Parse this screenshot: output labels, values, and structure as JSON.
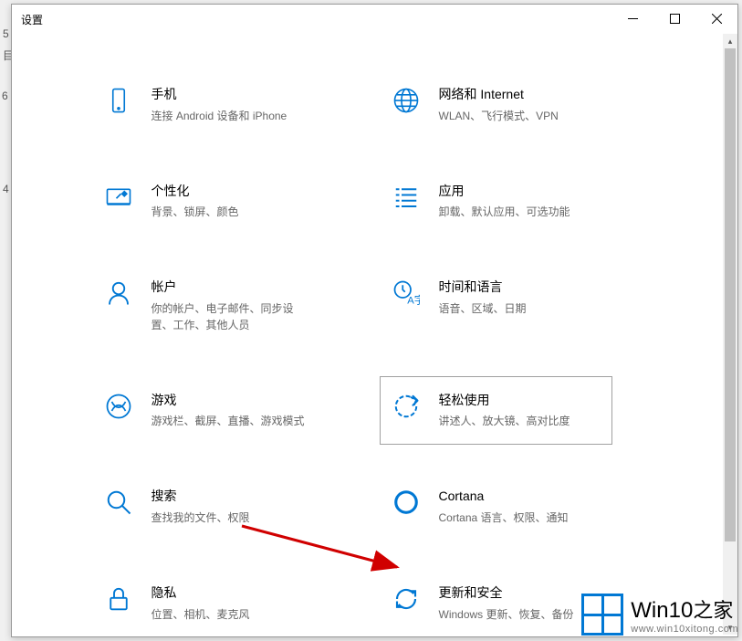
{
  "window": {
    "title": "设置"
  },
  "cards": [
    {
      "title": "手机",
      "subtitle": "连接 Android 设备和 iPhone",
      "icon": "phone-icon"
    },
    {
      "title": "网络和 Internet",
      "subtitle": "WLAN、飞行模式、VPN",
      "icon": "network-icon"
    },
    {
      "title": "个性化",
      "subtitle": "背景、锁屏、颜色",
      "icon": "personalization-icon"
    },
    {
      "title": "应用",
      "subtitle": "卸载、默认应用、可选功能",
      "icon": "apps-icon"
    },
    {
      "title": "帐户",
      "subtitle": "你的帐户、电子邮件、同步设置、工作、其他人员",
      "icon": "accounts-icon"
    },
    {
      "title": "时间和语言",
      "subtitle": "语音、区域、日期",
      "icon": "time-language-icon"
    },
    {
      "title": "游戏",
      "subtitle": "游戏栏、截屏、直播、游戏模式",
      "icon": "gaming-icon"
    },
    {
      "title": "轻松使用",
      "subtitle": "讲述人、放大镜、高对比度",
      "icon": "ease-of-access-icon",
      "hover": true
    },
    {
      "title": "搜索",
      "subtitle": "查找我的文件、权限",
      "icon": "search-icon"
    },
    {
      "title": "Cortana",
      "subtitle": "Cortana 语言、权限、通知",
      "icon": "cortana-icon"
    },
    {
      "title": "隐私",
      "subtitle": "位置、相机、麦克风",
      "icon": "privacy-icon"
    },
    {
      "title": "更新和安全",
      "subtitle": "Windows 更新、恢复、备份",
      "icon": "update-security-icon"
    }
  ],
  "watermark": {
    "title_part1": "Win10",
    "title_part2": "之家",
    "url": "www.win10xitong.com"
  },
  "left_fragments": [
    "5",
    "目",
    "6",
    "4"
  ]
}
